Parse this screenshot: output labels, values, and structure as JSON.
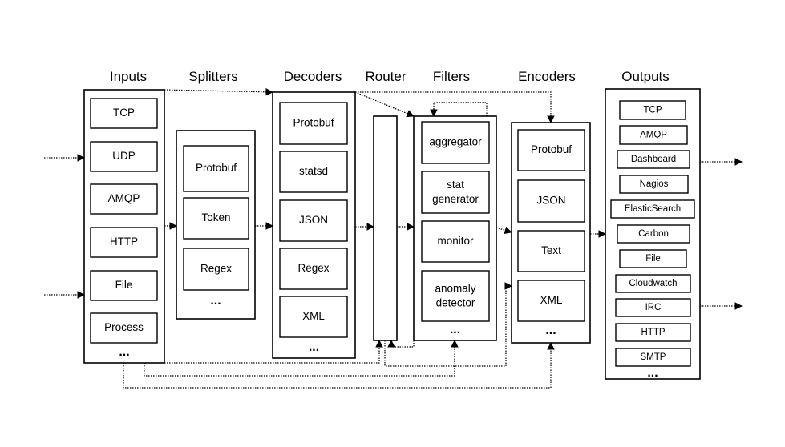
{
  "diagram": {
    "columns": [
      {
        "id": "inputs",
        "title": "Inputs",
        "items": [
          "TCP",
          "UDP",
          "AMQP",
          "HTTP",
          "File",
          "Process"
        ],
        "more": "..."
      },
      {
        "id": "splitters",
        "title": "Splitters",
        "items": [
          "Protobuf",
          "Token",
          "Regex"
        ],
        "more": "..."
      },
      {
        "id": "decoders",
        "title": "Decoders",
        "items": [
          "Protobuf",
          "statsd",
          "JSON",
          "Regex",
          "XML"
        ],
        "more": "..."
      },
      {
        "id": "router",
        "title": "Router",
        "items": [],
        "more": ""
      },
      {
        "id": "filters",
        "title": "Filters",
        "items": [
          "aggregator",
          "stat generator",
          "monitor",
          "anomaly detector"
        ],
        "more": "..."
      },
      {
        "id": "encoders",
        "title": "Encoders",
        "items": [
          "Protobuf",
          "JSON",
          "Text",
          "XML"
        ],
        "more": "..."
      },
      {
        "id": "outputs",
        "title": "Outputs",
        "items": [
          "TCP",
          "AMQP",
          "Dashboard",
          "Nagios",
          "ElasticSearch",
          "Carbon",
          "File",
          "Cloudwatch",
          "IRC",
          "HTTP",
          "SMTP"
        ],
        "more": "..."
      }
    ],
    "line_style": "dotted",
    "stroke_color": "#000000",
    "background": "#ffffff"
  }
}
